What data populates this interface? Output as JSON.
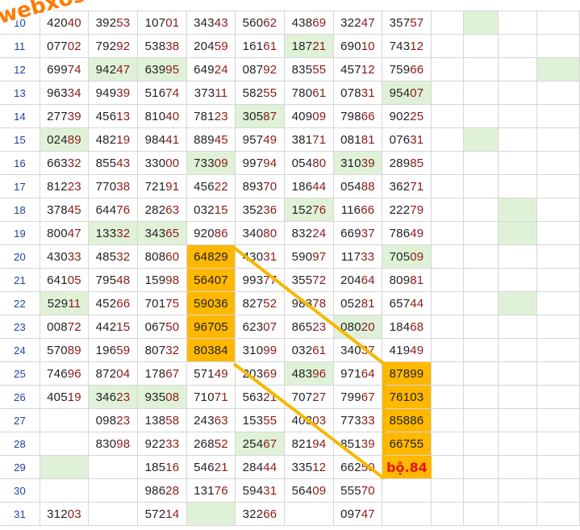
{
  "watermark": "webxoso.net",
  "annotation": "bộ.84",
  "colors": {
    "highlight_green": "#dff2d8",
    "highlight_orange": "#ffb800",
    "line_orange": "#f5b800",
    "annotation_red": "#e8140c"
  },
  "rows": [
    {
      "day": "10",
      "cells": [
        "42040",
        "39253",
        "10701",
        "34343",
        "56062",
        "43869",
        "32247",
        "35757",
        "",
        "",
        "",
        ""
      ]
    },
    {
      "day": "11",
      "cells": [
        "07702",
        "79292",
        "53838",
        "20459",
        "16161",
        "18721",
        "69010",
        "74312",
        "",
        "",
        "",
        ""
      ]
    },
    {
      "day": "12",
      "cells": [
        "69974",
        "94247",
        "63995",
        "64924",
        "08792",
        "83555",
        "45712",
        "75966",
        "",
        "",
        "",
        ""
      ]
    },
    {
      "day": "13",
      "cells": [
        "96334",
        "94939",
        "51674",
        "37311",
        "58255",
        "78061",
        "07831",
        "95407",
        "",
        "",
        "",
        ""
      ]
    },
    {
      "day": "14",
      "cells": [
        "27739",
        "45613",
        "81040",
        "78123",
        "30587",
        "40909",
        "79866",
        "90225",
        "",
        "",
        "",
        ""
      ]
    },
    {
      "day": "15",
      "cells": [
        "02489",
        "48219",
        "98441",
        "88945",
        "95749",
        "38171",
        "08181",
        "07631",
        "",
        "",
        "",
        ""
      ]
    },
    {
      "day": "16",
      "cells": [
        "66332",
        "85543",
        "33000",
        "73309",
        "99794",
        "05480",
        "31039",
        "28985",
        "",
        "",
        "",
        ""
      ]
    },
    {
      "day": "17",
      "cells": [
        "81223",
        "77038",
        "72191",
        "45622",
        "89370",
        "18644",
        "05488",
        "36271",
        "",
        "",
        "",
        ""
      ]
    },
    {
      "day": "18",
      "cells": [
        "37845",
        "64476",
        "28263",
        "03215",
        "35236",
        "15276",
        "11666",
        "22279",
        "",
        "",
        "",
        ""
      ]
    },
    {
      "day": "19",
      "cells": [
        "80047",
        "13332",
        "34365",
        "92086",
        "34080",
        "83224",
        "66937",
        "78649",
        "",
        "",
        "",
        ""
      ]
    },
    {
      "day": "20",
      "cells": [
        "43033",
        "48532",
        "80860",
        "64829",
        "43031",
        "59097",
        "11733",
        "70509",
        "",
        "",
        "",
        ""
      ]
    },
    {
      "day": "21",
      "cells": [
        "64105",
        "79548",
        "15998",
        "56407",
        "99377",
        "35572",
        "20464",
        "80981",
        "",
        "",
        "",
        ""
      ]
    },
    {
      "day": "22",
      "cells": [
        "52911",
        "45266",
        "70175",
        "59036",
        "82752",
        "98378",
        "05281",
        "65744",
        "",
        "",
        "",
        ""
      ]
    },
    {
      "day": "23",
      "cells": [
        "00872",
        "44215",
        "06750",
        "96705",
        "62307",
        "86523",
        "08020",
        "18468",
        "",
        "",
        "",
        ""
      ]
    },
    {
      "day": "24",
      "cells": [
        "57089",
        "19659",
        "80732",
        "80384",
        "31099",
        "03261",
        "34037",
        "41949",
        "",
        "",
        "",
        ""
      ]
    },
    {
      "day": "25",
      "cells": [
        "74696",
        "87204",
        "17867",
        "57149",
        "20369",
        "48396",
        "97164",
        "87899",
        "",
        "",
        "",
        ""
      ]
    },
    {
      "day": "26",
      "cells": [
        "40519",
        "34623",
        "93508",
        "71071",
        "56321",
        "70727",
        "79967",
        "76103",
        "",
        "",
        "",
        ""
      ]
    },
    {
      "day": "27",
      "cells": [
        "",
        "09823",
        "13858",
        "24363",
        "15355",
        "40303",
        "77333",
        "85886",
        "",
        "",
        "",
        ""
      ]
    },
    {
      "day": "28",
      "cells": [
        "",
        "83098",
        "92233",
        "26852",
        "25467",
        "82194",
        "85139",
        "66755",
        "",
        "",
        "",
        ""
      ]
    },
    {
      "day": "29",
      "cells": [
        "",
        "",
        "18516",
        "54621",
        "28444",
        "33512",
        "66250",
        "",
        "",
        "",
        "",
        ""
      ]
    },
    {
      "day": "30",
      "cells": [
        "",
        "",
        "98628",
        "13176",
        "59431",
        "56409",
        "55570",
        "",
        "",
        "",
        "",
        ""
      ]
    },
    {
      "day": "31",
      "cells": [
        "31203",
        "",
        "57214",
        "",
        "32266",
        "",
        "09747",
        "",
        "",
        "",
        "",
        ""
      ]
    }
  ]
}
